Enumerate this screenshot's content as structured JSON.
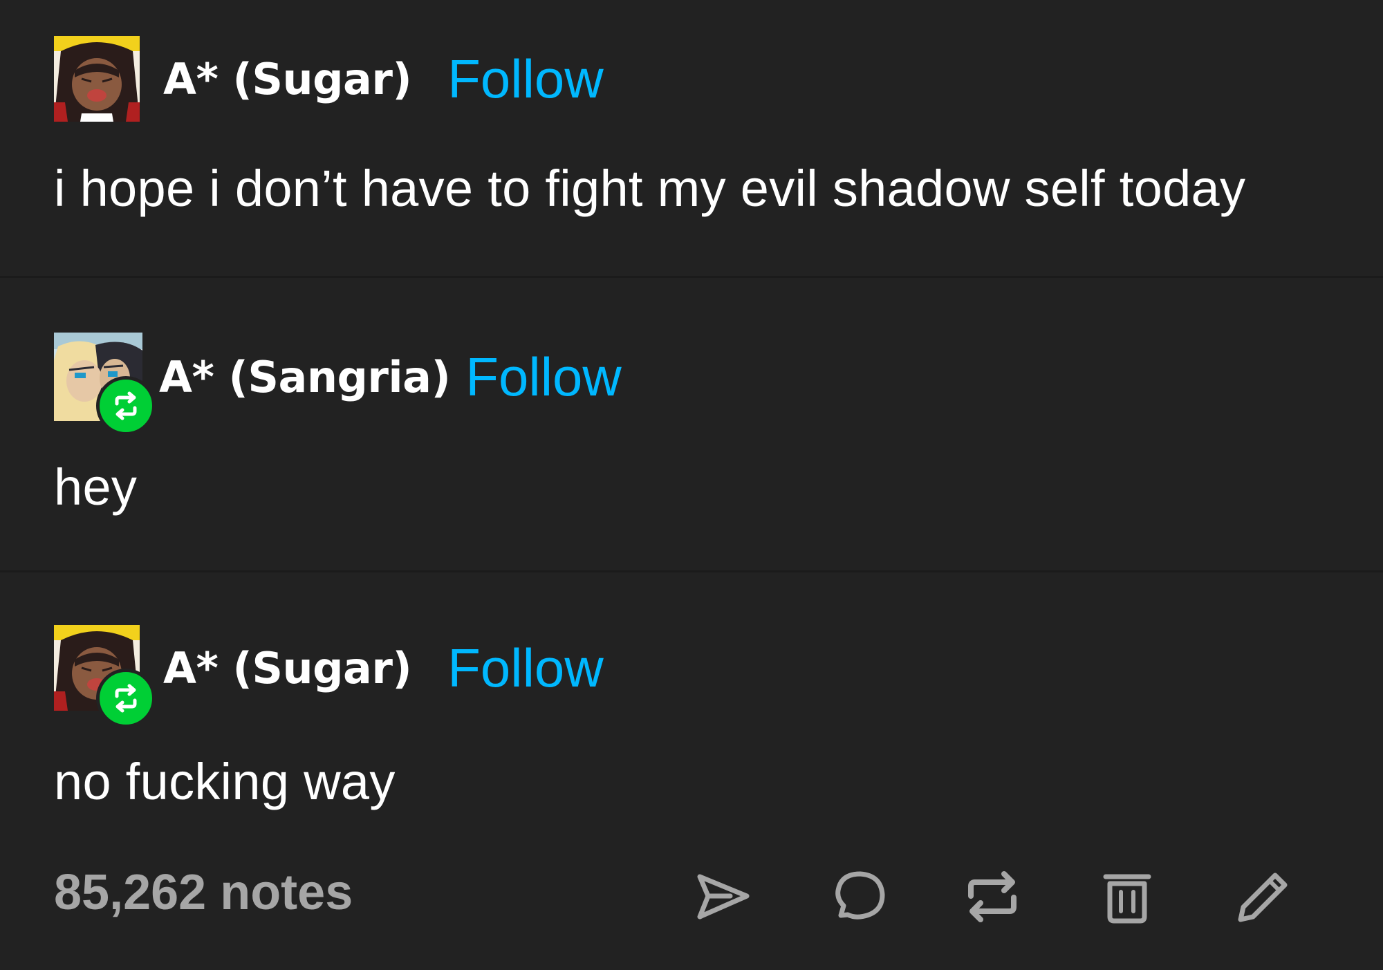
{
  "posts": [
    {
      "username": "A* (Sugar)",
      "follow_label": "Follow",
      "text": "i hope i don’t have to fight my evil shadow self today",
      "avatar_icon": "avatar-sugar",
      "reblog": false
    },
    {
      "username": "A* (Sangria)",
      "follow_label": "Follow",
      "text": "hey",
      "avatar_icon": "avatar-sangria",
      "reblog": true
    },
    {
      "username": "A* (Sugar)",
      "follow_label": "Follow",
      "text": "no fucking way",
      "avatar_icon": "avatar-sugar",
      "reblog": true
    }
  ],
  "footer": {
    "notes": "85,262 notes",
    "actions": [
      "share-icon",
      "reply-icon",
      "reblog-icon",
      "delete-icon",
      "edit-icon"
    ]
  },
  "colors": {
    "background": "#222222",
    "follow": "#00b8ff",
    "reblog_badge": "#00cf35",
    "notes": "#a6a6a6"
  }
}
